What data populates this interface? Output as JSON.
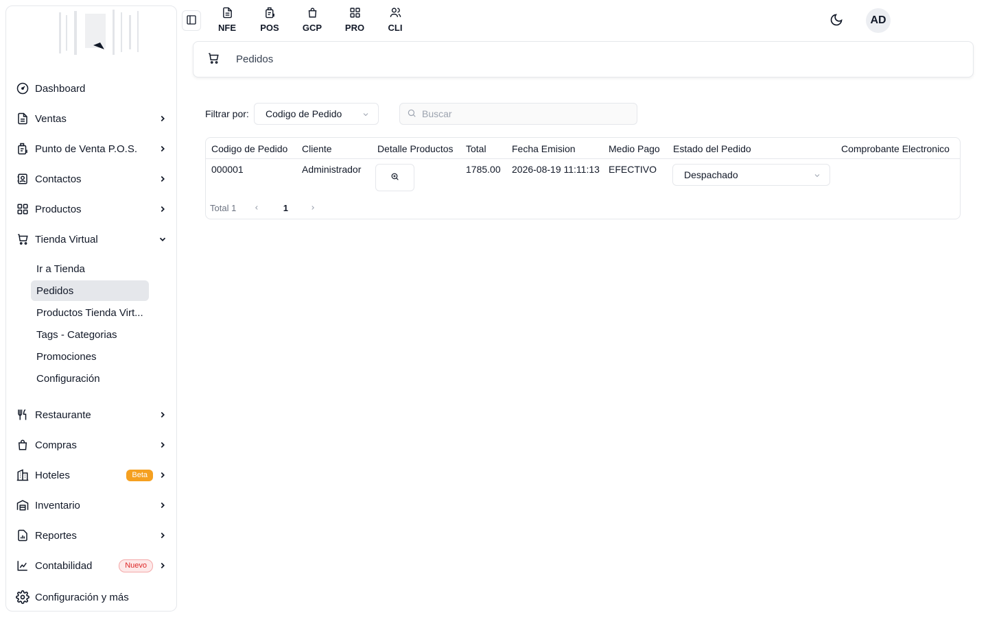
{
  "sidebar": {
    "items": [
      {
        "label": "Dashboard",
        "icon": "dashboard-gauge-icon",
        "chevron": ""
      },
      {
        "label": "Ventas",
        "icon": "document-icon",
        "chevron": "right"
      },
      {
        "label": "Punto de Venta P.O.S.",
        "icon": "pos-receipt-icon",
        "chevron": "right"
      },
      {
        "label": "Contactos",
        "icon": "contacts-icon",
        "chevron": "right"
      },
      {
        "label": "Productos",
        "icon": "grid-icon",
        "chevron": "right"
      },
      {
        "label": "Tienda Virtual",
        "icon": "cart-icon",
        "chevron": "down"
      },
      {
        "label": "Restaurante",
        "icon": "utensils-icon",
        "chevron": "right"
      },
      {
        "label": "Compras",
        "icon": "shopping-bag-icon",
        "chevron": "right"
      },
      {
        "label": "Hoteles",
        "icon": "building-icon",
        "chevron": "right",
        "badge": "Beta"
      },
      {
        "label": "Inventario",
        "icon": "warehouse-icon",
        "chevron": "right"
      },
      {
        "label": "Reportes",
        "icon": "report-icon",
        "chevron": "right"
      },
      {
        "label": "Contabilidad",
        "icon": "chart-icon",
        "chevron": "right",
        "badge": "Nuevo"
      },
      {
        "label": "Configuración y más",
        "icon": "gear-icon",
        "chevron": ""
      }
    ],
    "tienda_sub": [
      {
        "label": "Ir a Tienda"
      },
      {
        "label": "Pedidos",
        "active": true
      },
      {
        "label": "Productos Tienda Virt..."
      },
      {
        "label": "Tags - Categorias"
      },
      {
        "label": "Promociones"
      },
      {
        "label": "Configuración"
      }
    ]
  },
  "topnav": [
    {
      "label": "NFE",
      "icon": "document-icon"
    },
    {
      "label": "POS",
      "icon": "pos-receipt-icon"
    },
    {
      "label": "GCP",
      "icon": "shopping-bag-icon"
    },
    {
      "label": "PRO",
      "icon": "grid-icon"
    },
    {
      "label": "CLI",
      "icon": "users-icon"
    }
  ],
  "user": {
    "initials": "AD"
  },
  "page": {
    "title": "Pedidos"
  },
  "filter": {
    "label": "Filtrar por:",
    "selected": "Codigo de Pedido",
    "search_placeholder": "Buscar"
  },
  "table": {
    "columns": [
      "Codigo de Pedido",
      "Cliente",
      "Detalle Productos",
      "Total",
      "Fecha Emision",
      "Medio Pago",
      "Estado del Pedido",
      "Comprobante Electronico"
    ],
    "rows": [
      {
        "codigo": "000001",
        "cliente": "Administrador",
        "total": "1785.00",
        "fecha": "2026-08-19 11:11:13",
        "medio": "EFECTIVO",
        "estado": "Despachado",
        "comprobante": ""
      }
    ],
    "total_label": "Total 1",
    "current_page": "1"
  },
  "colors": {
    "accent": "#111827",
    "border": "#e5e7eb",
    "active_bg": "#e5e7eb",
    "beta": "#f5a020",
    "nuevo": "#dc2626"
  }
}
